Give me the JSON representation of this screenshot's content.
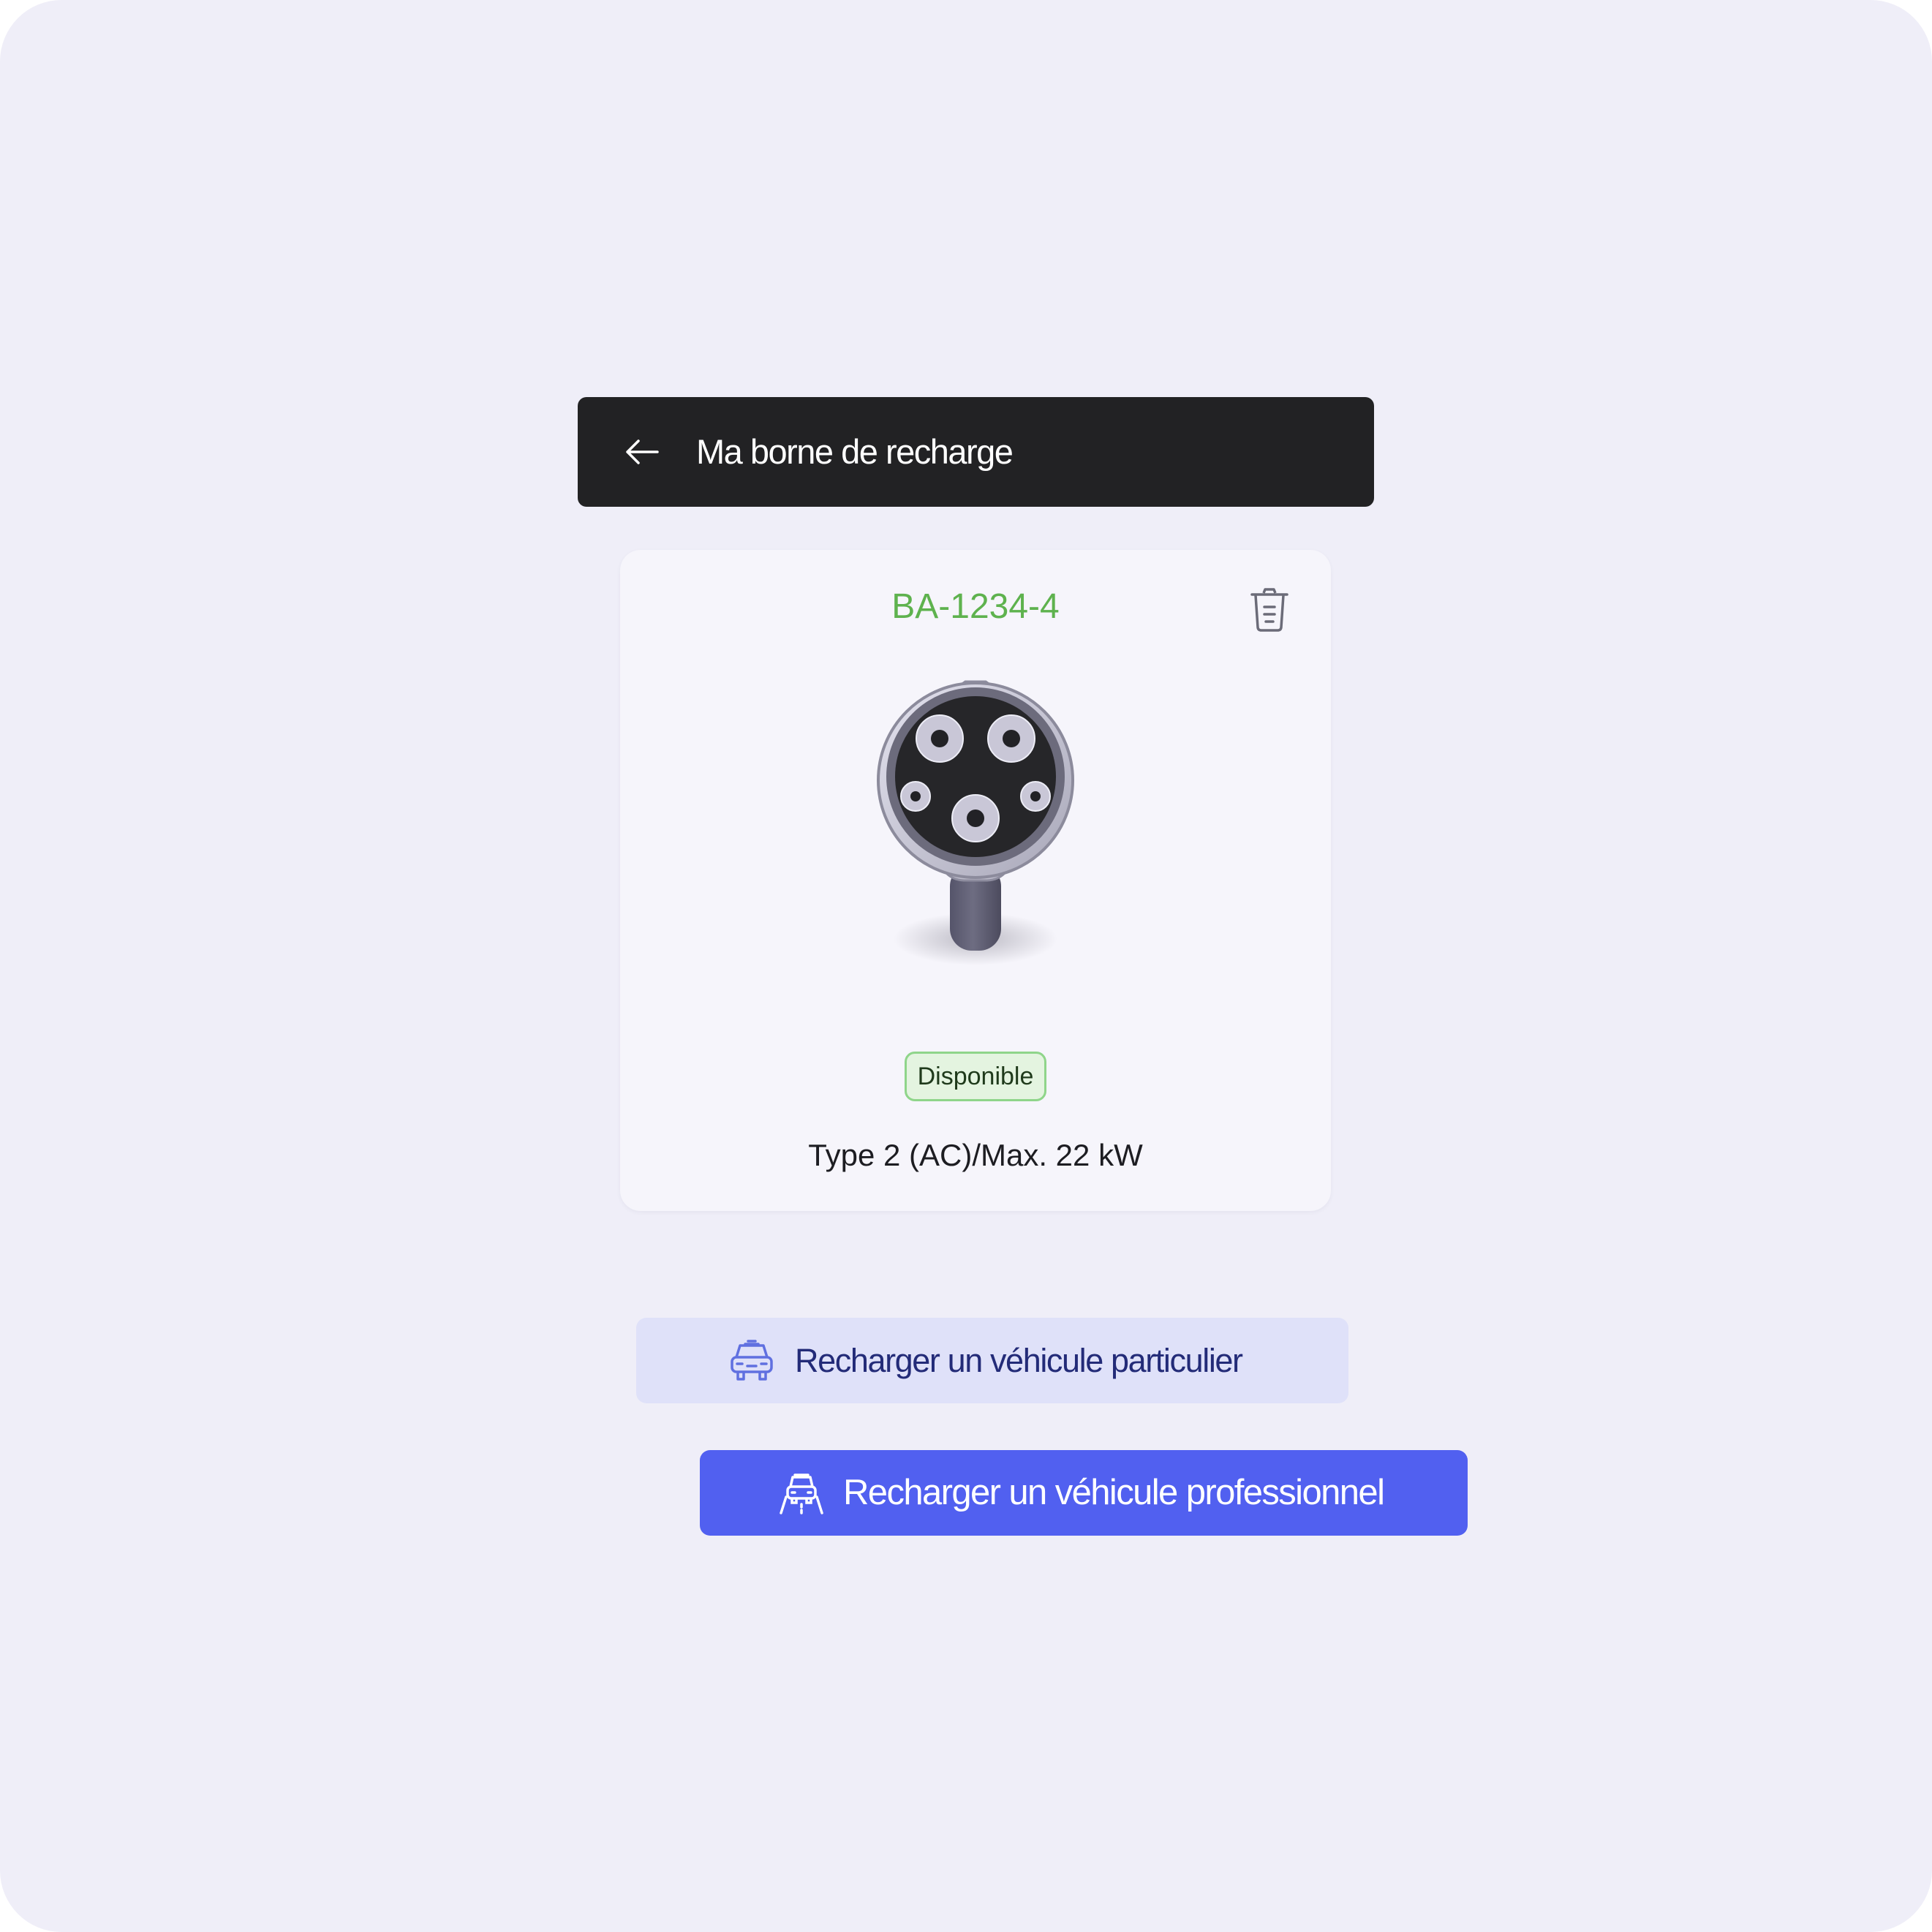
{
  "header": {
    "back_icon": "arrow-left-icon",
    "title": "Ma borne de recharge"
  },
  "station": {
    "id": "BA-1234-4",
    "delete_icon": "trash-icon",
    "connector_image": "type-2-connector-plug",
    "status": "Disponible",
    "connector_info": "Type 2 (AC)/Max. 22 kW"
  },
  "actions": {
    "private": {
      "icon": "car-icon",
      "label": "Recharger un véhicule particulier"
    },
    "professional": {
      "icon": "car-road-icon",
      "label": "Recharger un véhicule professionnel"
    }
  },
  "colors": {
    "background": "#efeef8",
    "header": "#222224",
    "card": "#f6f5fb",
    "station_id": "#5eb24e",
    "badge_bg": "#e4f4e0",
    "badge_border": "#8fd58a",
    "secondary_button": "#dfe1f9",
    "secondary_text": "#232b78",
    "primary_button": "#5160f0"
  }
}
